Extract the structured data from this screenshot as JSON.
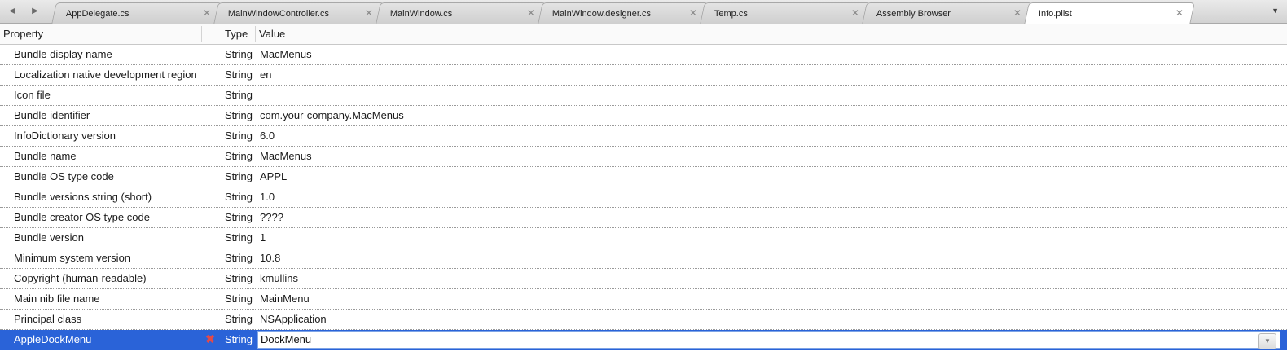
{
  "tabs": [
    {
      "label": "AppDelegate.cs"
    },
    {
      "label": "MainWindowController.cs"
    },
    {
      "label": "MainWindow.cs"
    },
    {
      "label": "MainWindow.designer.cs"
    },
    {
      "label": "Temp.cs"
    },
    {
      "label": "Assembly Browser"
    },
    {
      "label": "Info.plist",
      "active": true
    }
  ],
  "tab_close_glyph": "✕",
  "nav": {
    "back_icon": "chevron-left-icon",
    "forward_icon": "chevron-right-icon",
    "back_glyph": "◀",
    "forward_glyph": "▶"
  },
  "overflow_glyph": "▼",
  "columns": {
    "property": "Property",
    "type": "Type",
    "value": "Value"
  },
  "rows": [
    {
      "property": "Bundle display name",
      "type": "String",
      "value": "MacMenus"
    },
    {
      "property": "Localization native development region",
      "type": "String",
      "value": "en"
    },
    {
      "property": "Icon file",
      "type": "String",
      "value": ""
    },
    {
      "property": "Bundle identifier",
      "type": "String",
      "value": "com.your-company.MacMenus"
    },
    {
      "property": "InfoDictionary version",
      "type": "String",
      "value": "6.0"
    },
    {
      "property": "Bundle name",
      "type": "String",
      "value": "MacMenus"
    },
    {
      "property": "Bundle OS type code",
      "type": "String",
      "value": "APPL"
    },
    {
      "property": "Bundle versions string (short)",
      "type": "String",
      "value": "1.0"
    },
    {
      "property": "Bundle creator OS type code",
      "type": "String",
      "value": "????"
    },
    {
      "property": "Bundle version",
      "type": "String",
      "value": "1"
    },
    {
      "property": "Minimum system version",
      "type": "String",
      "value": "10.8"
    },
    {
      "property": "Copyright (human-readable)",
      "type": "String",
      "value": "kmullins"
    },
    {
      "property": "Main nib file name",
      "type": "String",
      "value": "MainMenu"
    },
    {
      "property": "Principal class",
      "type": "String",
      "value": "NSApplication"
    }
  ],
  "selected_row": {
    "property": "AppleDockMenu",
    "type": "String",
    "value": "DockMenu",
    "delete_glyph": "✖",
    "dropdown_glyph": "▼"
  },
  "colors": {
    "selection": "#2a63d8",
    "delete": "#e24a4a"
  }
}
